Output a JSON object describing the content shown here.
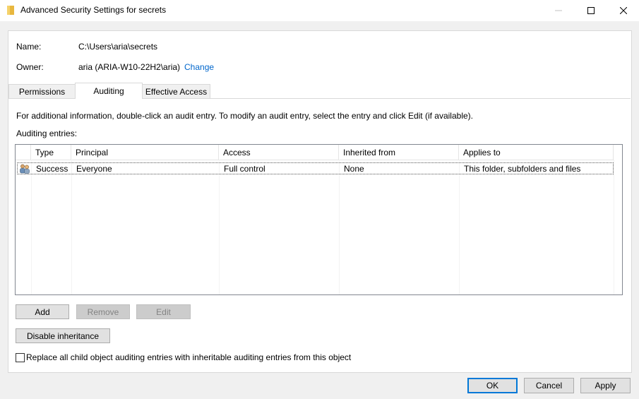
{
  "window": {
    "title": "Advanced Security Settings for secrets"
  },
  "info": {
    "name_label": "Name:",
    "name_value": "C:\\Users\\aria\\secrets",
    "owner_label": "Owner:",
    "owner_value": "aria (ARIA-W10-22H2\\aria)",
    "change_link": "Change"
  },
  "tabs": [
    {
      "label": "Permissions",
      "active": false
    },
    {
      "label": "Auditing",
      "active": true
    },
    {
      "label": "Effective Access",
      "active": false
    }
  ],
  "auditing": {
    "instructions": "For additional information, double-click an audit entry. To modify an audit entry, select the entry and click Edit (if available).",
    "entries_label": "Auditing entries:",
    "columns": [
      "Type",
      "Principal",
      "Access",
      "Inherited from",
      "Applies to"
    ],
    "rows": [
      {
        "icon": "users-icon",
        "type": "Success",
        "principal": "Everyone",
        "access": "Full control",
        "inherited_from": "None",
        "applies_to": "This folder, subfolders and files"
      }
    ]
  },
  "buttons": {
    "add": "Add",
    "remove": "Remove",
    "edit": "Edit",
    "disable_inheritance": "Disable inheritance",
    "ok": "OK",
    "cancel": "Cancel",
    "apply": "Apply"
  },
  "replace_checkbox": {
    "label": "Replace all child object auditing entries with inheritable auditing entries from this object",
    "checked": false
  }
}
